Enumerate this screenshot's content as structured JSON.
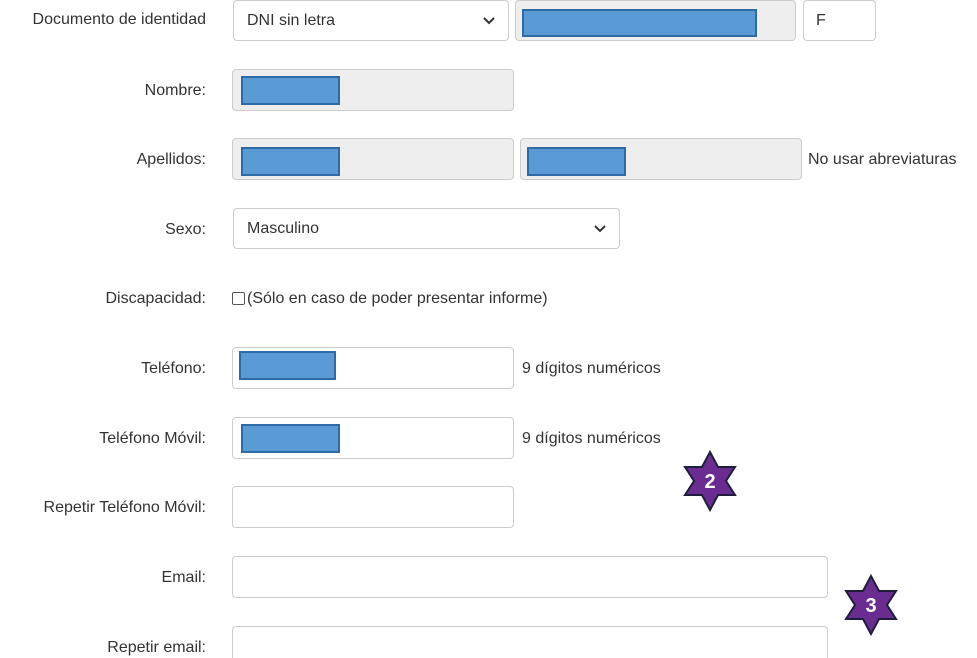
{
  "form": {
    "documento": {
      "label": "Documento de identidad",
      "type_value": "DNI sin letra",
      "letter_value": "F"
    },
    "nombre": {
      "label": "Nombre:"
    },
    "apellidos": {
      "label": "Apellidos:",
      "hint": "No usar abreviaturas"
    },
    "sexo": {
      "label": "Sexo:",
      "value": "Masculino"
    },
    "discapacidad": {
      "label": "Discapacidad:",
      "note": "(Sólo en caso de poder presentar informe)",
      "checked": false
    },
    "telefono": {
      "label": "Teléfono:",
      "hint": "9 dígitos numéricos"
    },
    "movil": {
      "label": "Teléfono Móvil:",
      "hint": "9 dígitos numéricos"
    },
    "repetir_movil": {
      "label": "Repetir Teléfono Móvil:",
      "value": ""
    },
    "email": {
      "label": "Email:",
      "value": ""
    },
    "repetir_email": {
      "label": "Repetir email:",
      "value": ""
    }
  },
  "annotations": {
    "marker_2": "2",
    "marker_3": "3",
    "color": "#6a2c91"
  },
  "colors": {
    "redaction": "#5b9bd5",
    "readonly_bg": "#eeeeee"
  }
}
